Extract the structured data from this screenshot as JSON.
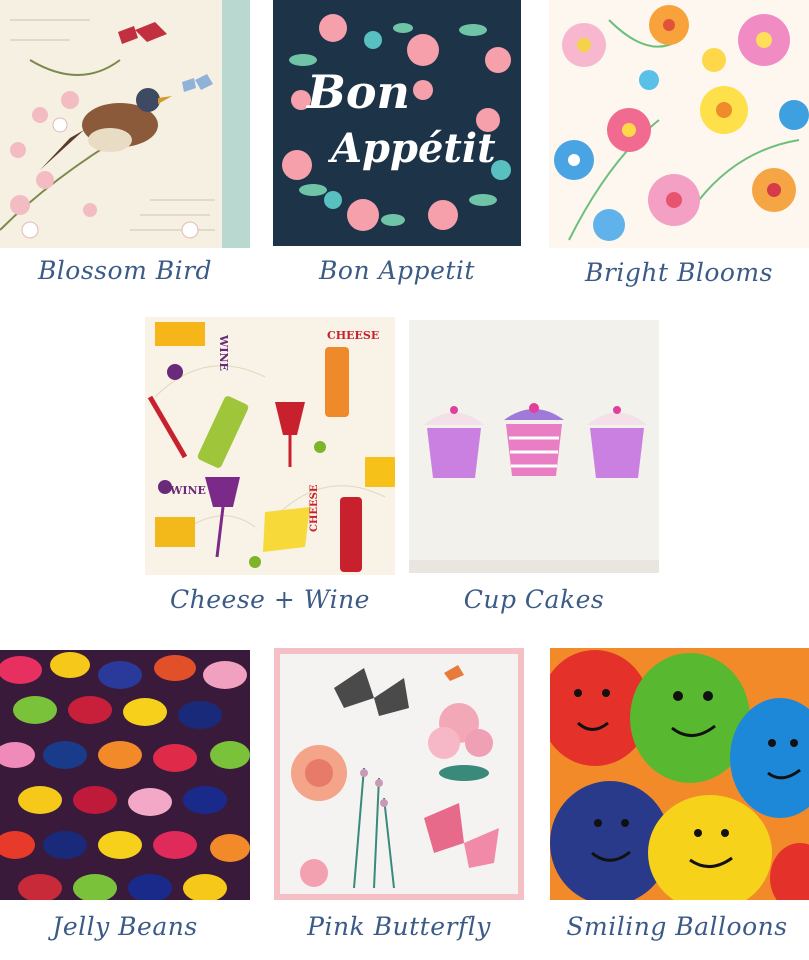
{
  "products": [
    {
      "id": "blossom-bird",
      "name": "Blossom Bird"
    },
    {
      "id": "bon-appetit",
      "name": "Bon Appetit",
      "artwork_text": [
        "Bon",
        "Appétit"
      ]
    },
    {
      "id": "bright-blooms",
      "name": "Bright Blooms"
    },
    {
      "id": "cheese-wine",
      "name": "Cheese + Wine",
      "artwork_text": [
        "WINE",
        "CHEESE",
        "WINE",
        "CHEESE"
      ]
    },
    {
      "id": "cup-cakes",
      "name": "Cup Cakes"
    },
    {
      "id": "jelly-beans",
      "name": "Jelly Beans"
    },
    {
      "id": "pink-butterfly",
      "name": "Pink Butterfly"
    },
    {
      "id": "smiling-balloons",
      "name": "Smiling Balloons"
    }
  ],
  "colors": {
    "caption": "#3b5b86",
    "bon_appetit_bg": "#1d3347",
    "cupcake_pink": "#c980e0",
    "bright_blooms_bg": "#fdf7ef"
  }
}
